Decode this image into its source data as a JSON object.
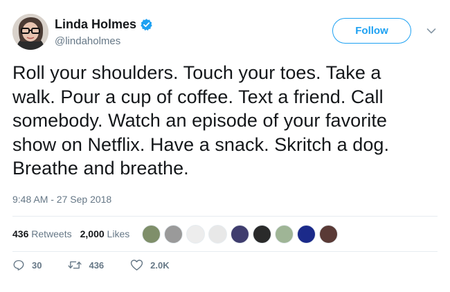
{
  "author": {
    "display_name": "Linda Holmes",
    "handle": "@lindaholmes",
    "verified": true,
    "avatar_icon": "profile-photo-avatar",
    "verified_icon": "verified-badge-icon"
  },
  "follow_button_label": "Follow",
  "menu_icon": "chevron-down-icon",
  "tweet": {
    "lines": [
      "Roll your shoulders. Touch your toes. Take a",
      "walk. Pour a cup of coffee. Text a friend. Call",
      "somebody. Watch an episode of your favorite",
      "show on Netflix. Have a snack. Skritch a dog.",
      "Breathe and breathe."
    ],
    "timestamp": "9:48 AM - 27 Sep 2018"
  },
  "stats": {
    "retweets_count": "436",
    "retweets_label": "Retweets",
    "likes_count": "2,000",
    "likes_label": "Likes",
    "liker_avatars": [
      "#7f8f6a",
      "#9a9a9a",
      "#ededed",
      "#e8e8e8",
      "#3f3d6e",
      "#2a2a2a",
      "#9fb596",
      "#1b2a8a",
      "#5a3a36"
    ]
  },
  "actions": {
    "reply_count": "30",
    "retweet_count": "436",
    "like_count": "2.0K"
  },
  "colors": {
    "accent": "#1da1f2",
    "text": "#14171a",
    "secondary_text": "#657786",
    "divider": "#e6ecf0"
  }
}
